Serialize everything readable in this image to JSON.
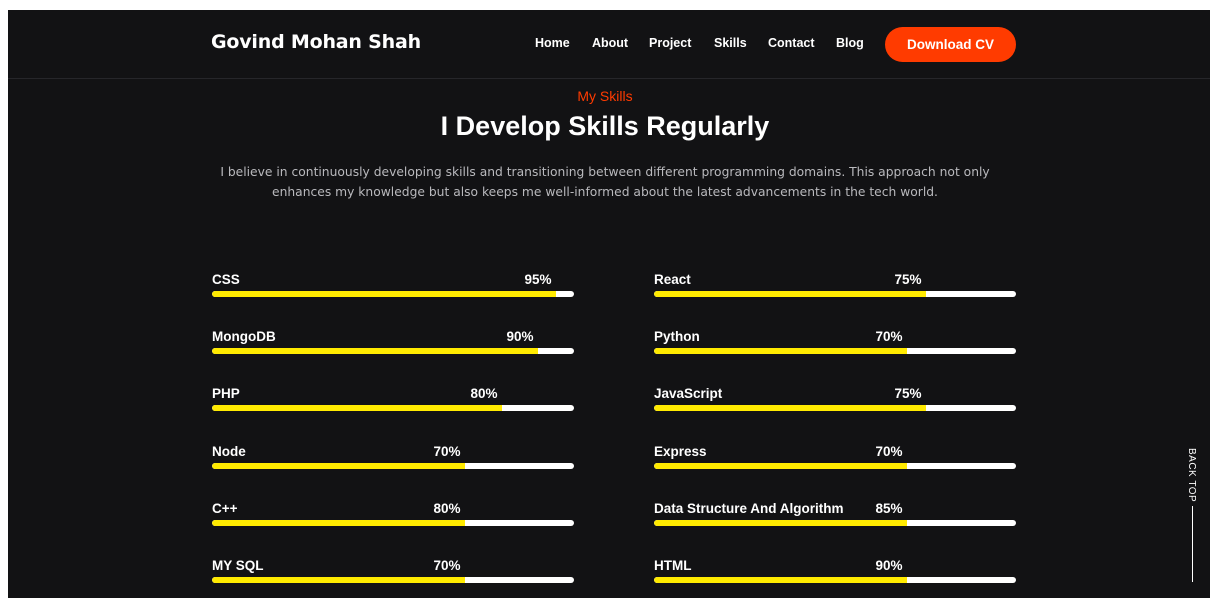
{
  "header": {
    "brand": "Govind Mohan Shah",
    "nav": [
      "Home",
      "About",
      "Project",
      "Skills",
      "Contact",
      "Blog"
    ],
    "cta_label": "Download CV"
  },
  "section": {
    "eyebrow": "My Skills",
    "title": "I Develop Skills Regularly",
    "description": "I believe in continuously developing skills and transitioning between different programming domains. This approach not only enhances my knowledge but also keeps me well-informed about the latest advancements in the tech world."
  },
  "skills_left": [
    {
      "name": "CSS",
      "percent_label": "95%",
      "level": 0.95
    },
    {
      "name": "MongoDB",
      "percent_label": "90%",
      "level": 0.9
    },
    {
      "name": "PHP",
      "percent_label": "80%",
      "level": 0.8
    },
    {
      "name": "Node",
      "percent_label": "70%",
      "level": 0.7
    },
    {
      "name": "C++",
      "percent_label": "80%",
      "level": 0.7
    },
    {
      "name": "MY SQL",
      "percent_label": "70%",
      "level": 0.7
    }
  ],
  "skills_right": [
    {
      "name": "React",
      "percent_label": "75%",
      "level": 0.75
    },
    {
      "name": "Python",
      "percent_label": "70%",
      "level": 0.7
    },
    {
      "name": "JavaScript",
      "percent_label": "75%",
      "level": 0.75
    },
    {
      "name": "Express",
      "percent_label": "70%",
      "level": 0.7
    },
    {
      "name": "Data Structure And Algorithm",
      "percent_label": "85%",
      "level": 0.7
    },
    {
      "name": "HTML",
      "percent_label": "90%",
      "level": 0.7
    }
  ],
  "back_top_label": "BACK TOP",
  "colors": {
    "background": "#121214",
    "accent": "#ff3b00",
    "bar_fill": "#ffea00",
    "bar_track": "#ffffff"
  }
}
